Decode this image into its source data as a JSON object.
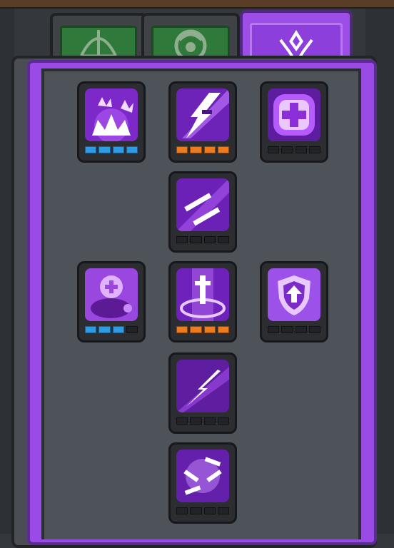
{
  "colors": {
    "panel_purple": "#9a4be6",
    "panel_gray": "#4b4f56",
    "tab_green": "#2f7a3a",
    "pip_blue": "#2f9be4",
    "pip_orange": "#ef7b1f",
    "pip_empty": "#222326"
  },
  "tabs": [
    {
      "icon": "bow-icon",
      "state": "inactive"
    },
    {
      "icon": "spiral-shield-icon",
      "state": "inactive"
    },
    {
      "icon": "crystal-crest-icon",
      "state": "active"
    }
  ],
  "skill_tree": {
    "rows": [
      {
        "skills": [
          {
            "icon": "purple-fire-burst-icon",
            "pips": [
              "blue",
              "blue",
              "blue",
              "blue"
            ]
          },
          {
            "icon": "lightning-strike-icon",
            "pips": [
              "orange",
              "orange",
              "orange",
              "orange"
            ]
          },
          {
            "icon": "heal-cross-icon",
            "pips": [
              "empty",
              "empty",
              "empty",
              "empty"
            ]
          }
        ]
      },
      {
        "skills": [
          {
            "icon": "twin-swords-icon",
            "pips": [
              "empty",
              "empty",
              "empty",
              "empty"
            ]
          }
        ]
      },
      {
        "skills": [
          {
            "icon": "pet-heal-icon",
            "pips": [
              "blue",
              "blue",
              "blue"
            ]
          },
          {
            "icon": "sword-pillar-icon",
            "pips": [
              "orange",
              "orange",
              "orange",
              "orange"
            ]
          },
          {
            "icon": "shield-up-icon",
            "pips": [
              "empty",
              "empty",
              "empty",
              "empty"
            ]
          }
        ]
      },
      {
        "skills": [
          {
            "icon": "piercing-thrust-icon",
            "pips": [
              "empty",
              "empty",
              "empty",
              "empty"
            ]
          }
        ]
      },
      {
        "skills": [
          {
            "icon": "blade-storm-icon",
            "pips": [
              "empty",
              "empty",
              "empty",
              "empty"
            ]
          }
        ]
      }
    ]
  }
}
